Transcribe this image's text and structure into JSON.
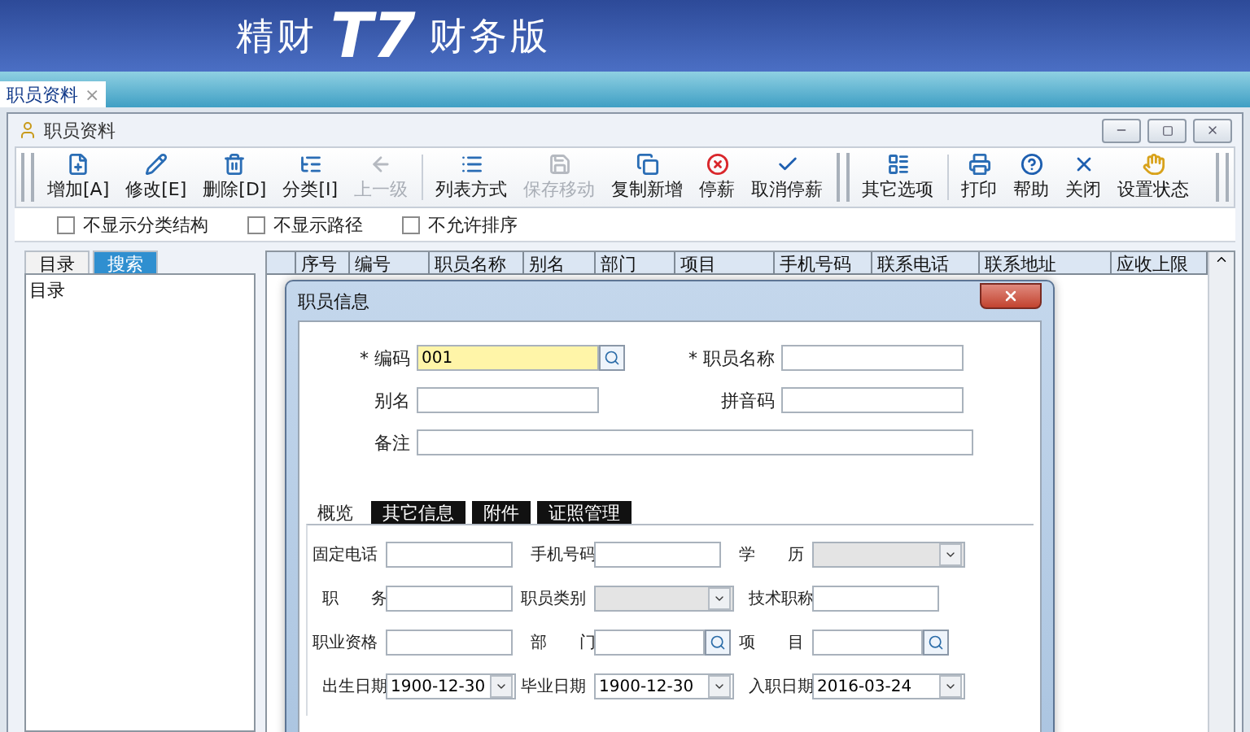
{
  "app": {
    "logo_left": "精财",
    "logo_mark": "T7",
    "logo_right": "财务版"
  },
  "doc_tabs": [
    {
      "label": "职员资料",
      "selected": true,
      "close": "×"
    }
  ],
  "window": {
    "title": "职员资料"
  },
  "toolbar": {
    "groups": [
      [
        {
          "label": "增加[A]",
          "disabled": false
        },
        {
          "label": "修改[E]",
          "disabled": false
        },
        {
          "label": "删除[D]",
          "disabled": false
        },
        {
          "label": "分类[I]",
          "disabled": false
        },
        {
          "label": "上一级",
          "disabled": true
        }
      ],
      [
        {
          "label": "列表方式",
          "disabled": false
        },
        {
          "label": "保存移动",
          "disabled": true
        },
        {
          "label": "复制新增",
          "disabled": false
        },
        {
          "label": "停薪",
          "disabled": false
        },
        {
          "label": "取消停薪",
          "disabled": false
        }
      ],
      [
        {
          "label": "其它选项",
          "disabled": false
        }
      ],
      [
        {
          "label": "打印",
          "disabled": false
        },
        {
          "label": "帮助",
          "disabled": false
        },
        {
          "label": "关闭",
          "disabled": false
        },
        {
          "label": "设置状态",
          "disabled": false
        }
      ]
    ]
  },
  "options": [
    {
      "label": "不显示分类结构",
      "checked": false
    },
    {
      "label": "不显示路径",
      "checked": false
    },
    {
      "label": "不允许排序",
      "checked": false
    }
  ],
  "sidebar": {
    "tabs": [
      {
        "label": "目录",
        "selected": true
      },
      {
        "label": "搜索",
        "selected": false
      }
    ],
    "tree": [
      {
        "label": "目录"
      }
    ]
  },
  "table": {
    "columns": [
      "序号",
      "编号",
      "职员名称",
      "别名",
      "部门",
      "项目",
      "手机号码",
      "联系电话",
      "联系地址",
      "应收上限"
    ]
  },
  "dialog": {
    "title": "职员信息",
    "fields": [
      {
        "label": "编码",
        "mark": "*",
        "kind": "lookup",
        "value": "001",
        "focused": true
      },
      {
        "label": "职员名称",
        "mark": "*",
        "kind": "text",
        "focused": false
      },
      {
        "label": "别名",
        "kind": "text",
        "focused": false
      },
      {
        "label": "拼音码",
        "kind": "text",
        "focused": false
      },
      {
        "label": "备注",
        "kind": "memo",
        "focused": false
      }
    ],
    "tabs": [
      {
        "label": "概览",
        "selected": true
      },
      {
        "label": "其它信息",
        "selected": false
      },
      {
        "label": "附件",
        "selected": false
      },
      {
        "label": "证照管理",
        "selected": false
      }
    ],
    "tab_fields": [
      {
        "label": "固定电话",
        "kind": "text"
      },
      {
        "label": "手机号码",
        "kind": "text"
      },
      {
        "label": "学　　历",
        "kind": "select",
        "disabled": true
      },
      {
        "label": "职　　务",
        "kind": "text"
      },
      {
        "label": "职员类别",
        "kind": "select",
        "disabled": true
      },
      {
        "label": "技术职称",
        "kind": "text"
      },
      {
        "label": "职业资格",
        "kind": "text"
      },
      {
        "label": "部　　门",
        "kind": "lookup"
      },
      {
        "label": "项　　目",
        "kind": "lookup"
      },
      {
        "label": "出生日期",
        "kind": "date",
        "value": "1900-12-30"
      },
      {
        "label": "毕业日期",
        "kind": "date",
        "value": "1900-12-30"
      },
      {
        "label": "入职日期",
        "kind": "date",
        "value": "2016-03-24"
      }
    ]
  }
}
